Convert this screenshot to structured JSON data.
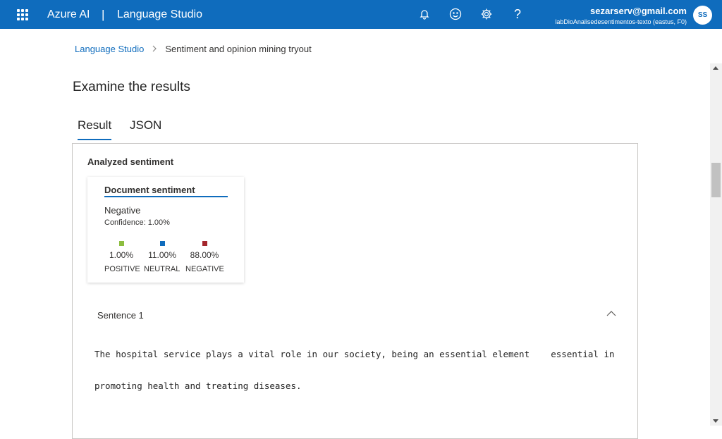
{
  "topbar": {
    "brand": "Azure AI",
    "separator": "|",
    "product": "Language Studio",
    "icons": [
      "bell-icon",
      "smiley-icon",
      "gear-icon",
      "help-icon"
    ],
    "account_email": "sezarserv@gmail.com",
    "account_directory": "labDioAnalisedesentimentos-texto (eastus, F0)",
    "avatar_initials": "SS",
    "bar_color": "#0f6cbd"
  },
  "breadcrumb": {
    "root": "Language Studio",
    "current": "Sentiment and opinion mining tryout"
  },
  "page_title": "Examine the results",
  "tabs": [
    {
      "label": "Result",
      "selected": true
    },
    {
      "label": "JSON",
      "selected": false
    }
  ],
  "results": {
    "section_label": "Analyzed sentiment",
    "document_card": {
      "title": "Document sentiment",
      "sentiment": "Negative",
      "confidence": "Confidence: 1.00%",
      "scores": [
        {
          "label": "POSITIVE",
          "value": "1.00%",
          "color": "#8cbd3f"
        },
        {
          "label": "NEUTRAL",
          "value": "11.00%",
          "color": "#0f6cbd"
        },
        {
          "label": "NEGATIVE",
          "value": "88.00%",
          "color": "#a4262c"
        }
      ]
    },
    "sentence": {
      "title": "Sentence 1",
      "text_line1": "The hospital service plays a vital role in our society, being an essential element    essential in",
      "text_line2": "promoting health and treating diseases."
    }
  }
}
